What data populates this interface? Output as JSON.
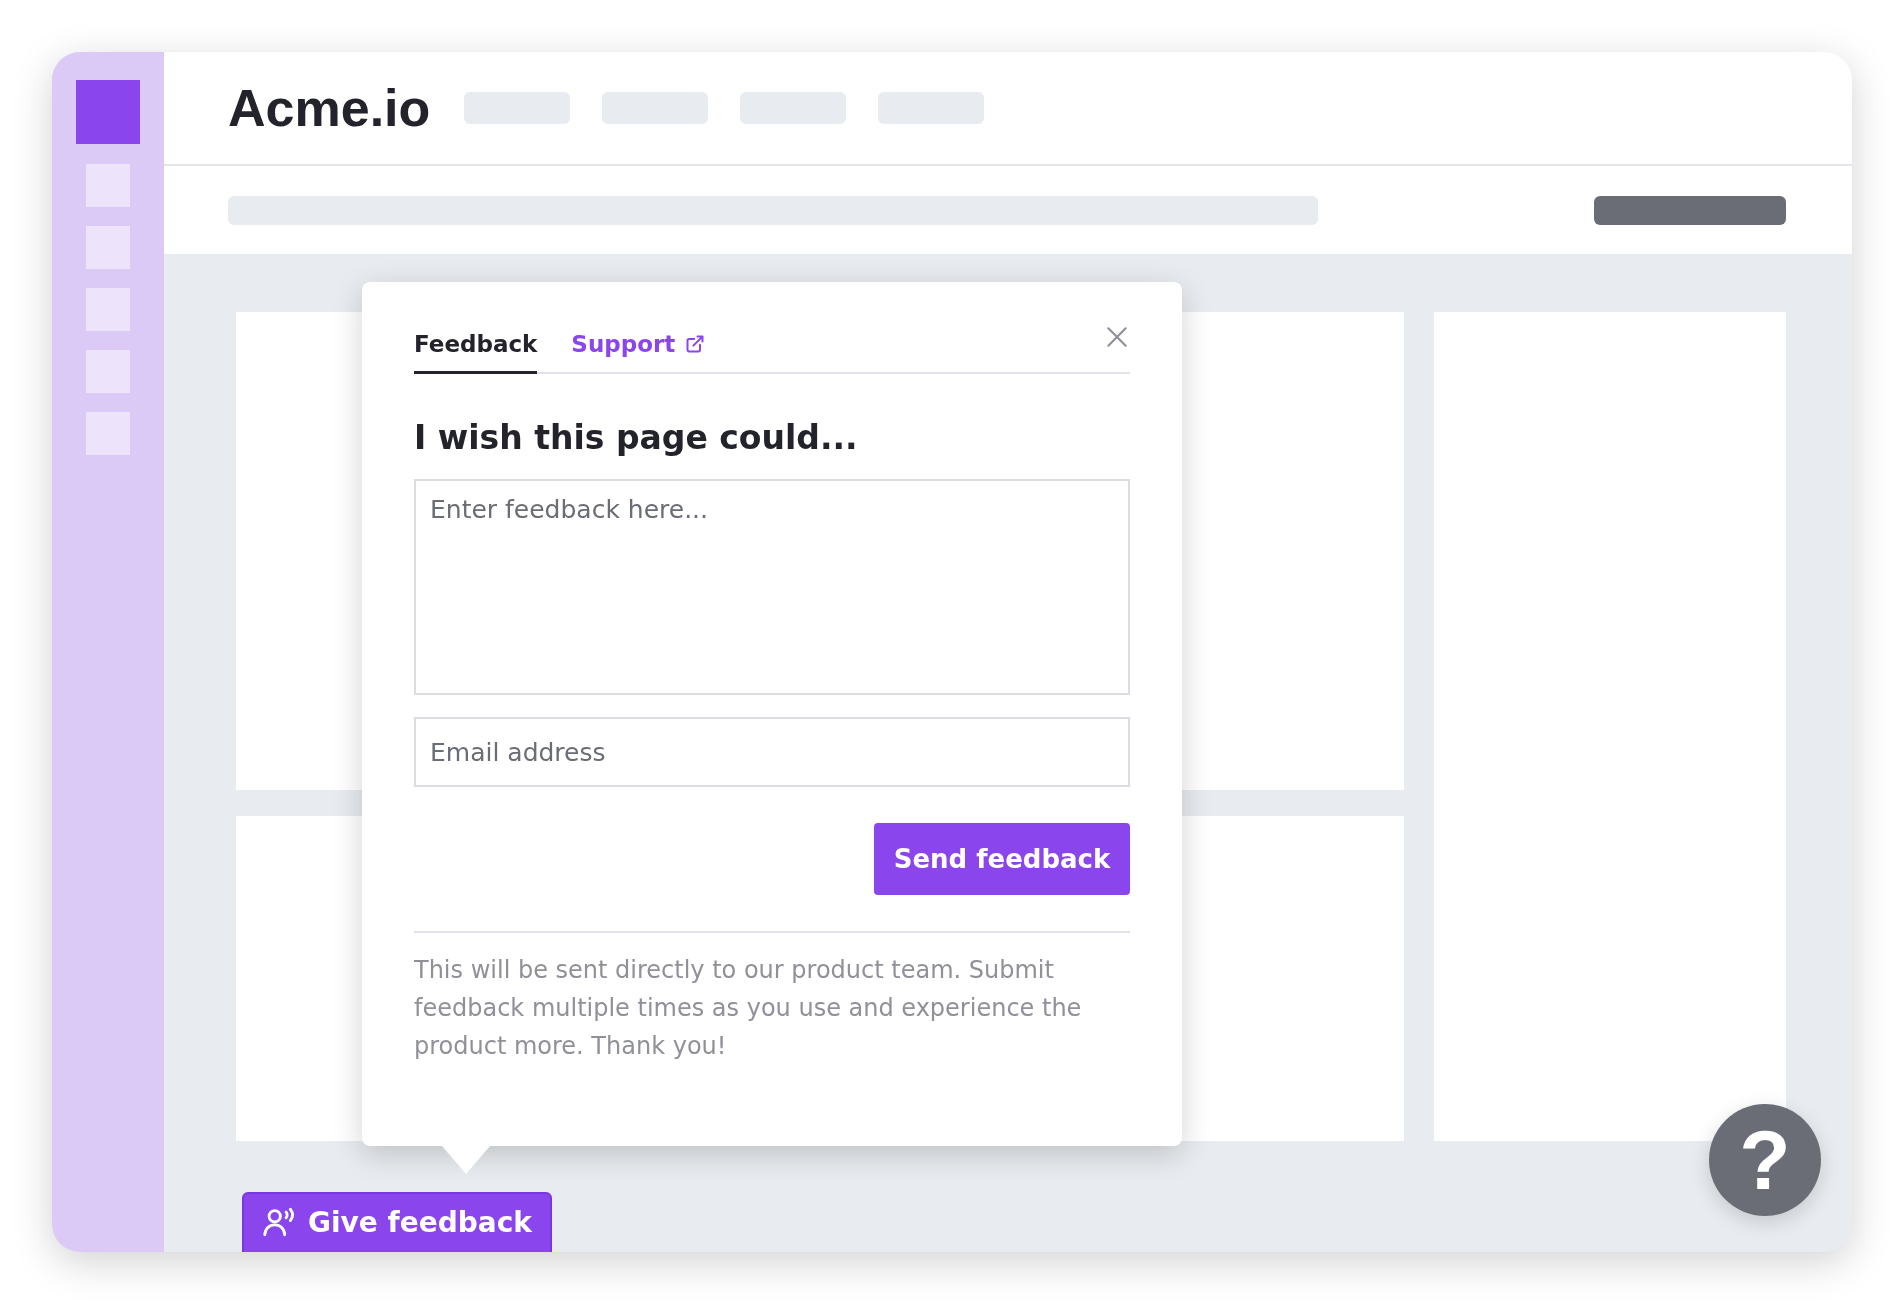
{
  "header": {
    "brand": "Acme.io"
  },
  "feedback_panel": {
    "tabs": [
      {
        "label": "Feedback",
        "selected": true,
        "external": false
      },
      {
        "label": "Support",
        "selected": false,
        "external": true
      }
    ],
    "heading": "I wish this page could...",
    "message": {
      "placeholder": "Enter feedback here..."
    },
    "email": {
      "placeholder": "Email address"
    },
    "submit": "Send feedback",
    "note": "This will be sent directly to our product team. Submit feedback multiple times as you use and experience the product more. Thank you!"
  },
  "give_feedback_button": "Give feedback",
  "help_button": "?"
}
